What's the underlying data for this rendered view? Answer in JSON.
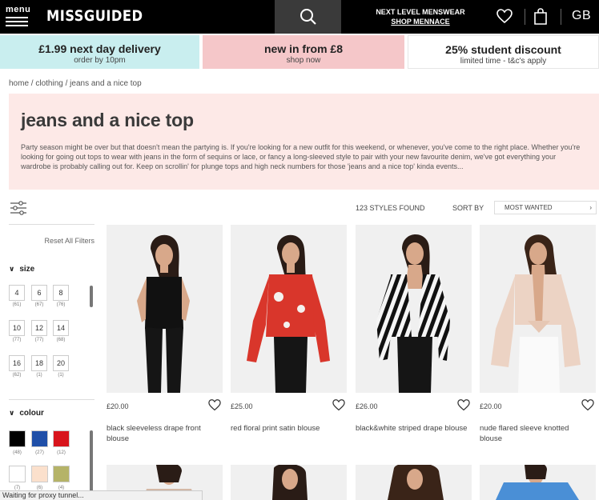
{
  "header": {
    "menu_label": "menu",
    "logo": "MISSGUIDED",
    "promo_line1": "NEXT LEVEL MENSWEAR",
    "promo_line2": "SHOP MENNACE",
    "region": "GB"
  },
  "banners": [
    {
      "title": "£1.99 next day delivery",
      "subtitle": "order by 10pm"
    },
    {
      "title": "new in from £8",
      "subtitle": "shop now"
    },
    {
      "title": "25% student discount",
      "subtitle": "limited time - t&c's apply"
    }
  ],
  "breadcrumb": {
    "home": "home",
    "clothing": "clothing",
    "current": "jeans and a nice top"
  },
  "intro": {
    "title": "jeans and a nice top",
    "text": "Party season might be over but that doesn't mean the partying is. If you're looking for a new outfit for this weekend, or whenever, you've come to the right place. Whether you're looking for going out tops to wear with jeans in the form of sequins or lace, or fancy a long-sleeved style to pair with your new favourite denim, we've got everything your wardrobe is probably calling out for. Keep on scrollin' for plunge tops and high neck numbers for those 'jeans and a nice top' kinda events..."
  },
  "toolbar": {
    "results": "123 STYLES FOUND",
    "sort_label": "SORT BY",
    "sort_value": "MOST WANTED"
  },
  "filters": {
    "reset": "Reset All Filters",
    "size_heading": "size",
    "sizes": [
      {
        "label": "4",
        "count": "(61)"
      },
      {
        "label": "6",
        "count": "(67)"
      },
      {
        "label": "8",
        "count": "(76)"
      },
      {
        "label": "10",
        "count": "(77)"
      },
      {
        "label": "12",
        "count": "(77)"
      },
      {
        "label": "14",
        "count": "(68)"
      },
      {
        "label": "16",
        "count": "(62)"
      },
      {
        "label": "18",
        "count": "(1)"
      },
      {
        "label": "20",
        "count": "(1)"
      }
    ],
    "colour_heading": "colour",
    "colours": [
      {
        "color": "#000000",
        "count": "(48)"
      },
      {
        "color": "#1f4fa8",
        "count": "(27)"
      },
      {
        "color": "#d8141c",
        "count": "(12)"
      },
      {
        "color": "#ffffff",
        "count": "(7)"
      },
      {
        "color": "#fbe0cc",
        "count": "(6)"
      },
      {
        "color": "#b5b368",
        "count": "(4)"
      }
    ]
  },
  "products": [
    {
      "price": "£20.00",
      "name": "black sleeveless drape front blouse"
    },
    {
      "price": "£25.00",
      "name": "red floral print satin blouse"
    },
    {
      "price": "£26.00",
      "name": "black&white striped drape blouse"
    },
    {
      "price": "£20.00",
      "name": "nude flared sleeve knotted blouse"
    }
  ],
  "status_bar": "Waiting for proxy tunnel..."
}
